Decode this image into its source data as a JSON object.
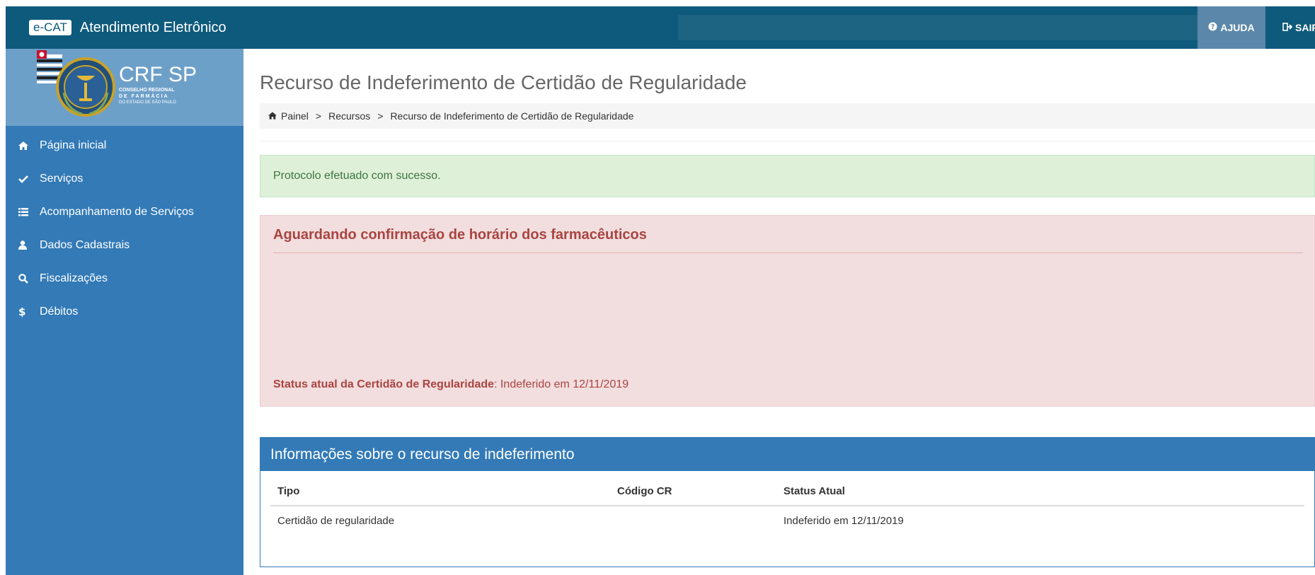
{
  "header": {
    "badge": "e-CAT",
    "title": "Atendimento Eletrônico",
    "help_label": "AJUDA",
    "logout_label": "SAIR"
  },
  "logo": {
    "name": "CRF SP",
    "sub1": "CONSELHO REGIONAL",
    "sub2": "DE FARMÁCIA",
    "sub3": "DO ESTADO DE SÃO PAULO"
  },
  "sidebar": {
    "items": [
      {
        "label": "Página inicial",
        "icon": "home-icon"
      },
      {
        "label": "Serviços",
        "icon": "check-icon"
      },
      {
        "label": "Acompanhamento de Serviços",
        "icon": "list-icon"
      },
      {
        "label": "Dados Cadastrais",
        "icon": "user-icon"
      },
      {
        "label": "Fiscalizações",
        "icon": "search-icon"
      },
      {
        "label": "Débitos",
        "icon": "dollar-icon"
      }
    ]
  },
  "page": {
    "title": "Recurso de Indeferimento de Certidão de Regularidade",
    "breadcrumb": [
      "Painel",
      "Recursos",
      "Recurso de Indeferimento de Certidão de Regularidade"
    ],
    "breadcrumb_separator": ">"
  },
  "alerts": {
    "success": "Protocolo efetuado com sucesso.",
    "danger_title": "Aguardando confirmação de horário dos farmacêuticos",
    "status_label": "Status atual da Certidão de Regularidade",
    "status_value": ": Indeferido em 12/11/2019"
  },
  "panel": {
    "title": "Informações sobre o recurso de indeferimento",
    "columns": [
      "Tipo",
      "Código CR",
      "Status Atual"
    ],
    "rows": [
      [
        "Certidão de regularidade",
        "",
        "Indeferido em 12/11/2019"
      ]
    ]
  },
  "colors": {
    "topbar": "#0e5a7c",
    "sidebar": "#337ab7",
    "success_bg": "#dff0d8",
    "danger_bg": "#f2dede",
    "danger_text": "#a94442"
  }
}
